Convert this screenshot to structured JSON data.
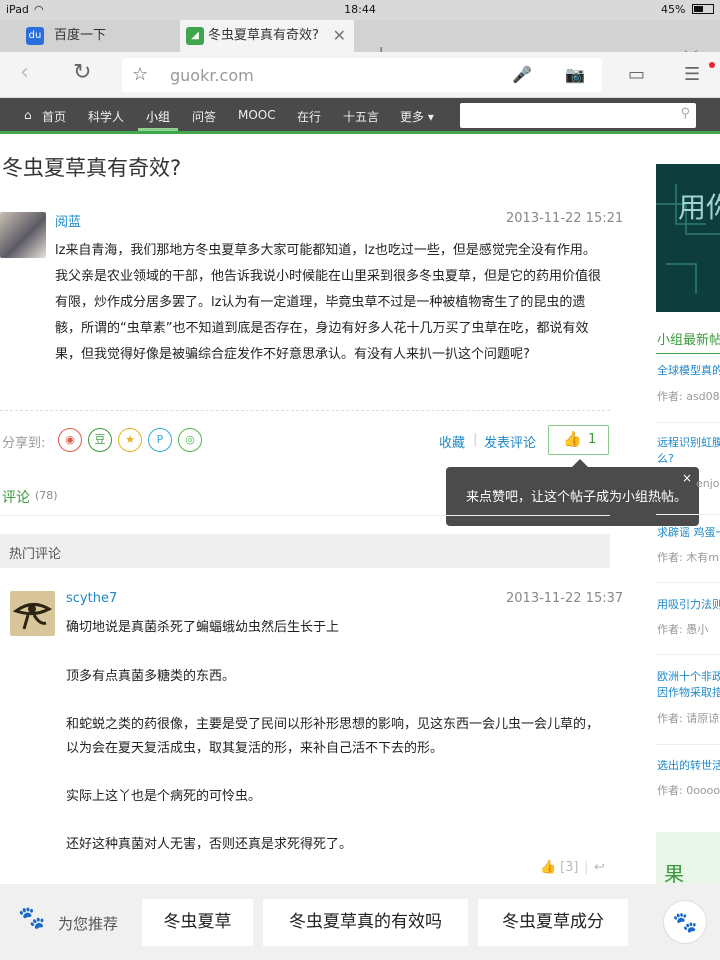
{
  "status": {
    "device": "iPad",
    "time": "18:44",
    "battery": "45%",
    "battery_level": 0.45
  },
  "browser": {
    "tabs": [
      {
        "label": "百度一下"
      },
      {
        "label": "冬虫夏草真有奇效?"
      }
    ],
    "url": "guokr.com"
  },
  "sitenav": {
    "items": [
      "首页",
      "科学人",
      "小组",
      "问答",
      "MOOC",
      "在行",
      "十五言",
      "更多 ▾"
    ],
    "active": "小组"
  },
  "post": {
    "title": "冬虫夏草真有奇效?",
    "author": "阅蓝",
    "date": "2013-11-22 15:21",
    "paragraphs": [
      "lz来自青海，我们那地方冬虫夏草多大家可能都知道，lz也吃过一些，但是感觉完全没有作用。",
      "我父亲是农业领域的干部，他告诉我说小时候能在山里采到很多冬虫夏草，但是它的药用价值很",
      "有限，炒作成分居多罢了。lz认为有一定道理，毕竟虫草不过是一种被植物寄生了的昆虫的遗",
      "骸，所谓的“虫草素”也不知道到底是否存在，身边有好多人花十几万买了虫草在吃，都说有效",
      "果，但我觉得好像是被骗综合症发作不好意思承认。有没有人来扒一扒这个问题呢?"
    ]
  },
  "share": {
    "label": "分享到:",
    "icons": [
      {
        "name": "weibo-icon",
        "glyph": "◉",
        "color": "#e05a4a"
      },
      {
        "name": "douban-icon",
        "glyph": "豆",
        "color": "#3a9a3a"
      },
      {
        "name": "qzone-icon",
        "glyph": "★",
        "color": "#e8b020"
      },
      {
        "name": "pinterest-icon",
        "glyph": "P",
        "color": "#3aa9d8"
      },
      {
        "name": "wechat-icon",
        "glyph": "◎",
        "color": "#4ab84a"
      }
    ]
  },
  "actions": {
    "collect": "收藏",
    "sep": "|",
    "comment": "发表评论",
    "like_count": "1"
  },
  "tooltip": {
    "text": "来点赞吧，让这个帖子成为小组热帖。",
    "close": "×"
  },
  "comments_tab": {
    "label": "评论",
    "count": "(78)"
  },
  "hot": {
    "label": "热门评论",
    "reply": {
      "author": "scythe7",
      "date": "2013-11-22 15:37",
      "paragraphs": [
        "确切地说是真菌杀死了蝙蝠蛾幼虫然后生长于上",
        "顶多有点真菌多糖类的东西。",
        "和蛇蜕之类的药很像，主要是受了民间以形补形思想的影响，见这东西一会儿虫一会儿草的，",
        "以为会在夏天复活成虫，取其复活的形，来补自己活不下去的形。",
        "实际上这丫也是个病死的可怜虫。",
        "还好这种真菌对人无害，否则还真是求死得死了。"
      ],
      "likes": "[3]"
    }
  },
  "sidebar": {
    "banner_text": "用你",
    "heading": "小组最新帖",
    "items": [
      {
        "title": [
          "全球模型真的"
        ],
        "meta": "作者:  asd08"
      },
      {
        "title": [
          "远程识别虹膜",
          "么?"
        ],
        "meta": "enjoh"
      },
      {
        "title": [
          "求辟谣 鸡蛋一"
        ],
        "meta": "作者:  木有m"
      },
      {
        "title": [
          "用吸引力法则"
        ],
        "meta": "作者:  愚小"
      },
      {
        "title": [
          "欧洲十个非政",
          "因作物采取措"
        ],
        "meta": "作者:  请原谅"
      },
      {
        "title": [
          "选出的转世活"
        ],
        "meta": "作者:  0oooo"
      }
    ],
    "ad_text": "果"
  },
  "recommend": {
    "label": "为您推荐",
    "chips": [
      "冬虫夏草",
      "冬虫夏草真的有效吗",
      "冬虫夏草成分"
    ],
    "paw": "🐾"
  }
}
